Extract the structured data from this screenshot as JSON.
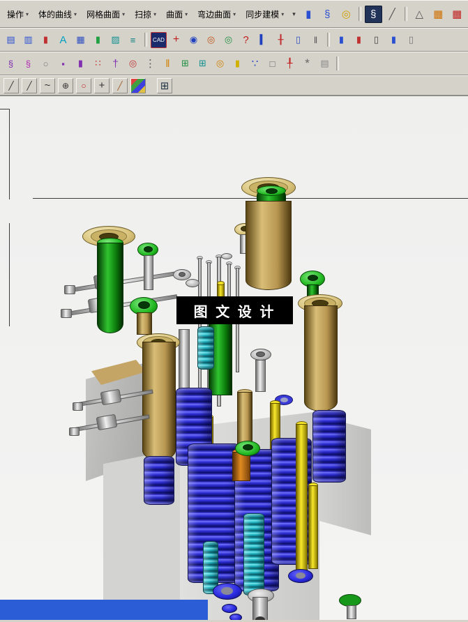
{
  "colors": {
    "toolbar_bg": "#d5d2ca",
    "viewport_bg": "#f2f2f1",
    "watermark_bg": "#000000",
    "watermark_fg": "#ffffff",
    "spring_blue": "#2a2ad0",
    "spring_cyan": "#1fb6c4",
    "bolt_green": "#22b822",
    "bushing_tan": "#d9be77",
    "flange_cream": "#ead98f",
    "pin_yellow": "#f5e52a",
    "block_gray": "#d0d0d0",
    "bottom_bar_blue": "#2b5dd6"
  },
  "menubar": {
    "arrow": "▾",
    "overflow": "▾",
    "items": [
      {
        "name": "operation",
        "label": "操作"
      },
      {
        "name": "body-curve",
        "label": "体的曲线"
      },
      {
        "name": "mesh-surface",
        "label": "网格曲面"
      },
      {
        "name": "sweep",
        "label": "扫掠"
      },
      {
        "name": "surface",
        "label": "曲面"
      },
      {
        "name": "flange-surface",
        "label": "弯边曲面"
      },
      {
        "name": "synchronous-modeling",
        "label": "同步建模"
      }
    ]
  },
  "toolbars": {
    "row1a": [
      {
        "name": "boss",
        "glyph": "▮",
        "fg": "#2a4fd0"
      },
      {
        "name": "spring-blue",
        "glyph": "§",
        "fg": "#2a4fd0"
      },
      {
        "name": "coil-yellow",
        "glyph": "◎",
        "fg": "#d0a000"
      },
      "|",
      {
        "name": "spring-tool",
        "glyph": "§",
        "fg": "#ffffff",
        "bg": "#22335a",
        "bd": "#101a30"
      },
      {
        "name": "sketch-pen",
        "glyph": "╱",
        "fg": "#555555"
      },
      "|"
    ],
    "row1b": [
      {
        "name": "draft-triangle",
        "glyph": "△",
        "fg": "#555555"
      },
      {
        "name": "sheet-orange",
        "glyph": "▦",
        "fg": "#d07000"
      },
      {
        "name": "mesh-red",
        "glyph": "▦",
        "fg": "#c02020"
      }
    ],
    "row2": [
      {
        "name": "datum-planes",
        "glyph": "▤",
        "fg": "#2a4fd0"
      },
      {
        "name": "sketch",
        "glyph": "▥",
        "fg": "#2a4fd0"
      },
      {
        "name": "bars",
        "glyph": "▮",
        "fg": "#c03030"
      },
      {
        "name": "text",
        "glyph": "A",
        "fg": "#00a0c0",
        "fs": 15
      },
      {
        "name": "checker-mesh",
        "glyph": "▦",
        "fg": "#3050c0"
      },
      {
        "name": "extrude",
        "glyph": "▮",
        "fg": "#20a040"
      },
      {
        "name": "hatch",
        "glyph": "▨",
        "fg": "#109090"
      },
      {
        "name": "list",
        "glyph": "≡",
        "fg": "#108080"
      },
      "|",
      {
        "name": "cad-badge",
        "glyph": "CAD",
        "fg": "#ffffff",
        "bg": "#1a2a6a",
        "bd": "#c03030",
        "fs": 8
      },
      {
        "name": "trim-red",
        "glyph": "+",
        "fg": "#c02020",
        "fs": 16
      },
      {
        "name": "eye",
        "glyph": "◉",
        "fg": "#2040c0"
      },
      {
        "name": "orbit",
        "glyph": "◎",
        "fg": "#c05010"
      },
      {
        "name": "snap-target",
        "glyph": "◎",
        "fg": "#209040"
      },
      {
        "name": "help",
        "glyph": "?",
        "fg": "#c02020",
        "fs": 15
      },
      {
        "name": "gauge",
        "glyph": "▍",
        "fg": "#2040c0"
      },
      {
        "name": "stud",
        "glyph": "╂",
        "fg": "#c03030"
      },
      {
        "name": "pin-column",
        "glyph": "▯",
        "fg": "#3050c0"
      },
      {
        "name": "guide-pair",
        "glyph": "‖",
        "fg": "#555555"
      },
      "|",
      {
        "name": "column-blue",
        "glyph": "▮",
        "fg": "#2a4fd0"
      },
      {
        "name": "column-red",
        "glyph": "▮",
        "fg": "#c03030"
      },
      {
        "name": "column-outline",
        "glyph": "▯",
        "fg": "#444444"
      },
      {
        "name": "column-blue2",
        "glyph": "▮",
        "fg": "#2a4fd0"
      },
      {
        "name": "column-gray",
        "glyph": "▯",
        "fg": "#777777"
      }
    ],
    "row3": [
      {
        "name": "spring-purple",
        "glyph": "§",
        "fg": "#8030b0"
      },
      {
        "name": "wire-spring",
        "glyph": "§",
        "fg": "#b030b0"
      },
      {
        "name": "ring",
        "glyph": "○",
        "fg": "#777777"
      },
      {
        "name": "insert",
        "glyph": "▪",
        "fg": "#8030b0"
      },
      {
        "name": "column-purple",
        "glyph": "▮",
        "fg": "#8030b0"
      },
      {
        "name": "points",
        "glyph": "∷",
        "fg": "#c03030"
      },
      {
        "name": "screw",
        "glyph": "†",
        "fg": "#8030b0",
        "fs": 15
      },
      {
        "name": "locator",
        "glyph": "◎",
        "fg": "#c03030"
      },
      {
        "name": "dots",
        "glyph": "⋮",
        "fg": "#555555",
        "fs": 15
      },
      {
        "name": "double-column",
        "glyph": "‖",
        "fg": "#d08000",
        "fs": 15
      },
      {
        "name": "pocket-green",
        "glyph": "⊞",
        "fg": "#209040"
      },
      {
        "name": "cavity-teal",
        "glyph": "⊞",
        "fg": "#109090"
      },
      {
        "name": "o-ring",
        "glyph": "◎",
        "fg": "#d08000"
      },
      {
        "name": "pin-yellow",
        "glyph": "▮",
        "fg": "#d0b000"
      },
      {
        "name": "balls",
        "glyph": "∵",
        "fg": "#2040c0",
        "fs": 15
      },
      {
        "name": "box",
        "glyph": "□",
        "fg": "#666666"
      },
      {
        "name": "bolt-red",
        "glyph": "╀",
        "fg": "#c02020"
      },
      {
        "name": "gear",
        "glyph": "*",
        "fg": "#666666",
        "fs": 17
      },
      {
        "name": "sheet",
        "glyph": "▤",
        "fg": "#888888"
      },
      "|"
    ],
    "row4": [
      {
        "name": "line1",
        "glyph": "╱",
        "fg": "#333333"
      },
      {
        "name": "line2",
        "glyph": "╱",
        "fg": "#333333"
      },
      {
        "name": "spline",
        "glyph": "~",
        "fg": "#333333",
        "fs": 15
      },
      {
        "name": "circle-cross",
        "glyph": "⊕",
        "fg": "#333333"
      },
      {
        "name": "circle-red",
        "glyph": "○",
        "fg": "#c02020"
      },
      {
        "name": "plus",
        "glyph": "+",
        "fg": "#333333",
        "fs": 15
      },
      {
        "name": "line3",
        "glyph": "╱",
        "fg": "#a06030"
      },
      {
        "name": "palette",
        "glyph": "",
        "bg": "linear-gradient(135deg,#e04040 25%,#40a040 25% 50%,#4040e0 50% 75%,#e0c040 75%)"
      }
    ],
    "row4b": [
      {
        "name": "grid",
        "glyph": "⊞",
        "fg": "#223344",
        "fs": 15
      }
    ]
  },
  "viewport": {
    "watermark": "图 文 设 计"
  }
}
